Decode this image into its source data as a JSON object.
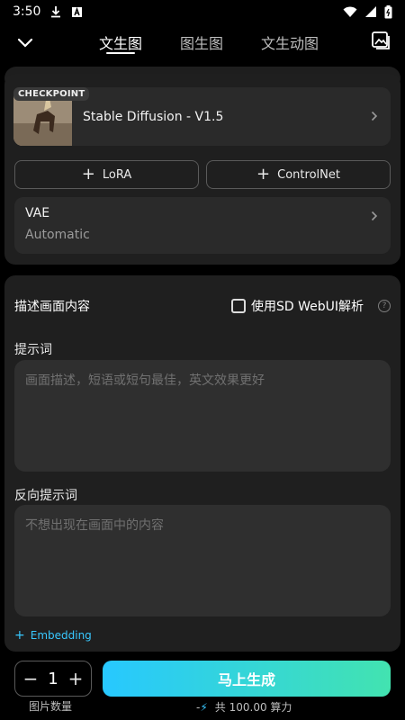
{
  "status_bar": {
    "time": "3:50",
    "icons": [
      "download-icon",
      "a-box-icon",
      "wifi-icon",
      "signal-icon",
      "battery-icon"
    ]
  },
  "nav": {
    "tabs": [
      {
        "label": "文生图",
        "active": true
      },
      {
        "label": "图生图",
        "active": false
      },
      {
        "label": "文生动图",
        "active": false
      }
    ]
  },
  "checkpoint": {
    "badge": "CHECKPOINT",
    "name": "Stable Diffusion - V1.5"
  },
  "buttons": {
    "lora": "LoRA",
    "controlnet": "ControlNet"
  },
  "vae": {
    "title": "VAE",
    "value": "Automatic"
  },
  "describe": {
    "title": "描述画面内容",
    "option_label": "使用SD WebUI解析",
    "help": "?"
  },
  "prompt": {
    "label": "提示词",
    "placeholder": "画面描述，短语或短句最佳，英文效果更好"
  },
  "negative": {
    "label": "反向提示词",
    "placeholder": "不想出现在画面中的内容"
  },
  "embedding": {
    "label": "Embedding"
  },
  "bottom": {
    "count_value": "1",
    "count_label": "图片数量",
    "generate_label": "马上生成",
    "cost_prefix": "-",
    "cost_text": "共 100.00 算力"
  },
  "colors": {
    "accent": "#38c8ff",
    "gradient_start": "#27c8ff",
    "gradient_end": "#42e3b0"
  }
}
